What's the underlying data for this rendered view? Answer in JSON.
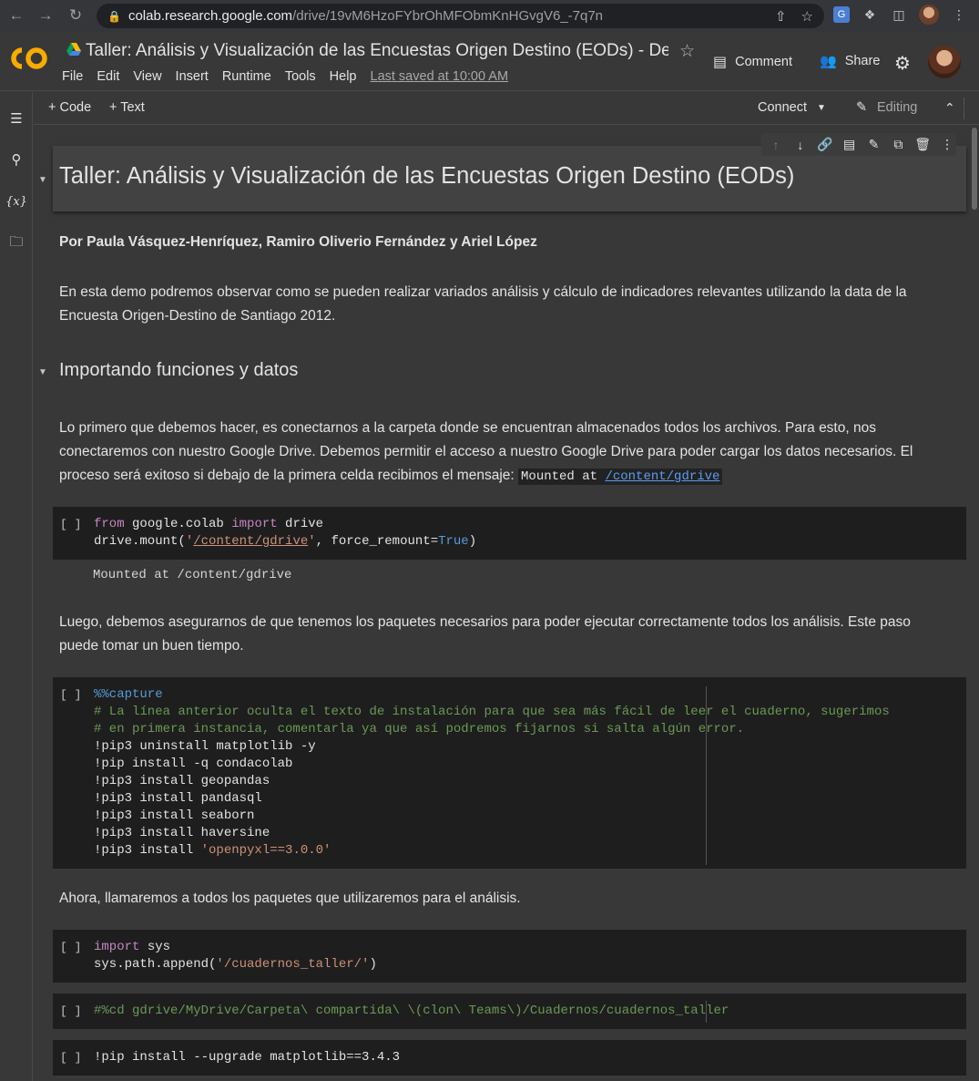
{
  "browser": {
    "url_host": "colab.research.google.com",
    "url_path": "/drive/19vM6HzoFYbrOhMFObmKnHGvgV6_-7q7n"
  },
  "header": {
    "title": "Taller: Análisis y Visualización de las Encuestas Origen Destino (EODs) - Demo ...",
    "menu": [
      "File",
      "Edit",
      "View",
      "Insert",
      "Runtime",
      "Tools",
      "Help"
    ],
    "last_saved": "Last saved at 10:00 AM",
    "comment_label": "Comment",
    "share_label": "Share"
  },
  "toolbar": {
    "add_code": "+ Code",
    "add_text": "+ Text",
    "connect": "Connect",
    "editing": "Editing"
  },
  "notebook": {
    "title_heading": "Taller: Análisis y Visualización de las Encuestas Origen Destino (EODs)",
    "authors": "Por Paula Vásquez-Henríquez, Ramiro Oliverio Fernández y Ariel López",
    "intro": "En esta demo podremos observar como se pueden realizar variados análisis y cálculo de indicadores relevantes utilizando la data de la Encuesta Origen-Destino de Santiago 2012.",
    "section1": "Importando funciones y datos",
    "para1": "Lo primero que debemos hacer, es conectarnos a la carpeta donde se encuentran almacenados todos los archivos. Para esto, nos conectaremos con nuestro Google Drive. Debemos permitir el acceso a nuestro Google Drive para poder cargar los datos necesarios. El proceso será exitoso si debajo de la primera celda recibimos el mensaje:",
    "para1_code_prefix": "Mounted at ",
    "para1_code_link": "/content/gdrive",
    "run_marker": "[ ]",
    "cell1_output": "Mounted at /content/gdrive",
    "para2": "Luego, debemos asegurarnos de que tenemos los paquetes necesarios para poder ejecutar correctamente todos los análisis. Este paso puede tomar un buen tiempo.",
    "para3": "Ahora, llamaremos a todos los paquetes que utilizaremos para el análisis.",
    "cell2": {
      "magic": "%%capture",
      "comment1": "# La línea anterior oculta el texto de instalación para que sea más fácil de leer el cuaderno, sugerimos",
      "comment2": "# en primera instancia, comentarla ya que así podremos fijarnos si salta algún error.",
      "lines": [
        "!pip3 uninstall matplotlib -y",
        "!pip install -q condacolab",
        "!pip3 install geopandas",
        "!pip3 install pandasql",
        "!pip3 install seaborn",
        "!pip3 install haversine"
      ],
      "last_prefix": "!pip3 install ",
      "last_str": "'openpyxl==3.0.0'"
    },
    "cell4": "#%cd gdrive/MyDrive/Carpeta\\ compartida\\ \\(clon\\ Teams\\)/Cuadernos/cuadernos_taller",
    "cell5": "!pip install --upgrade matplotlib==3.4.3"
  }
}
